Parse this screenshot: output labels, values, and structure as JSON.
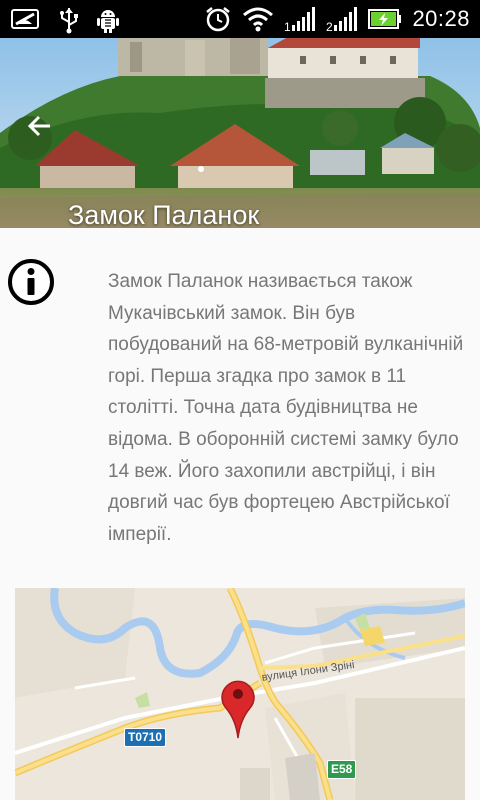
{
  "status_bar": {
    "time": "20:28",
    "icons": [
      "notification-icon",
      "usb-icon",
      "android-debug-icon",
      "alarm-icon",
      "wifi-icon",
      "signal-1-icon",
      "signal-2-icon",
      "battery-charging-icon"
    ],
    "battery_color": "#6bd12f"
  },
  "header": {
    "title": "Замок Паланок",
    "back_icon": "arrow-left-icon"
  },
  "info": {
    "icon": "info-icon",
    "description": "Замок Паланок називається також Мукачівський замок. Він був побудований на 68-метровій вулканічній горі. Перша згадка про замок в 11 столітті. Точна дата будівництва не відома. В оборонній системі замку було 14 веж. Його захопили австрійці, і він довгий час був фортецею Австрійської імперії."
  },
  "map": {
    "road_shield_1": "T0710",
    "road_shield_2": "E58",
    "street_label": "вулиця Ілони Зріні",
    "marker_icon": "map-pin-icon",
    "marker_color": "#d9272a"
  }
}
